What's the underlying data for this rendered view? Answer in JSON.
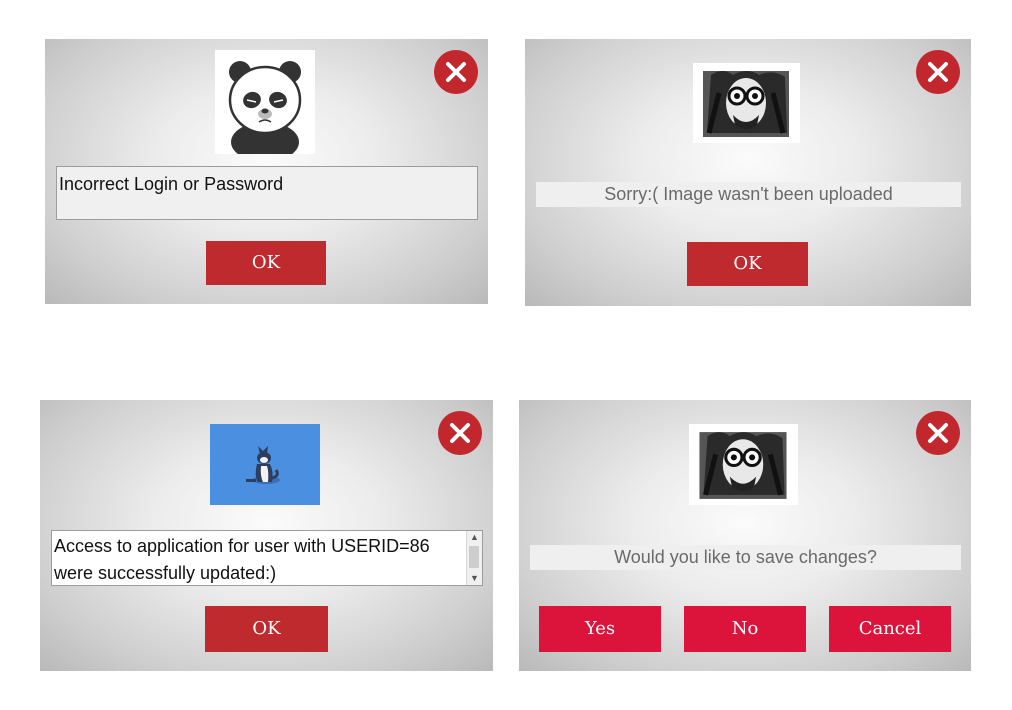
{
  "dialogs": [
    {
      "image": "sad-panda",
      "message": "Incorrect Login or Password",
      "buttons": [
        "OK"
      ]
    },
    {
      "image": "binocular-man",
      "message": "Sorry:( Image wasn't been uploaded",
      "buttons": [
        "OK"
      ]
    },
    {
      "image": "husky-dog",
      "message_lines": [
        "Access to application for user with USERID=86",
        "were successfully updated:)"
      ],
      "buttons": [
        "OK"
      ]
    },
    {
      "image": "binocular-man",
      "message": "Would you like to save changes?",
      "buttons": [
        "Yes",
        "No",
        "Cancel"
      ]
    }
  ],
  "icons": {
    "close": "close-x-icon",
    "scroll_up": "chevron-up-icon",
    "scroll_down": "chevron-down-icon"
  },
  "colors": {
    "close": "#c1272d",
    "ok_button": "#be2a2d",
    "choice_button": "#dc143c",
    "image_blue": "#4a8fe0"
  }
}
